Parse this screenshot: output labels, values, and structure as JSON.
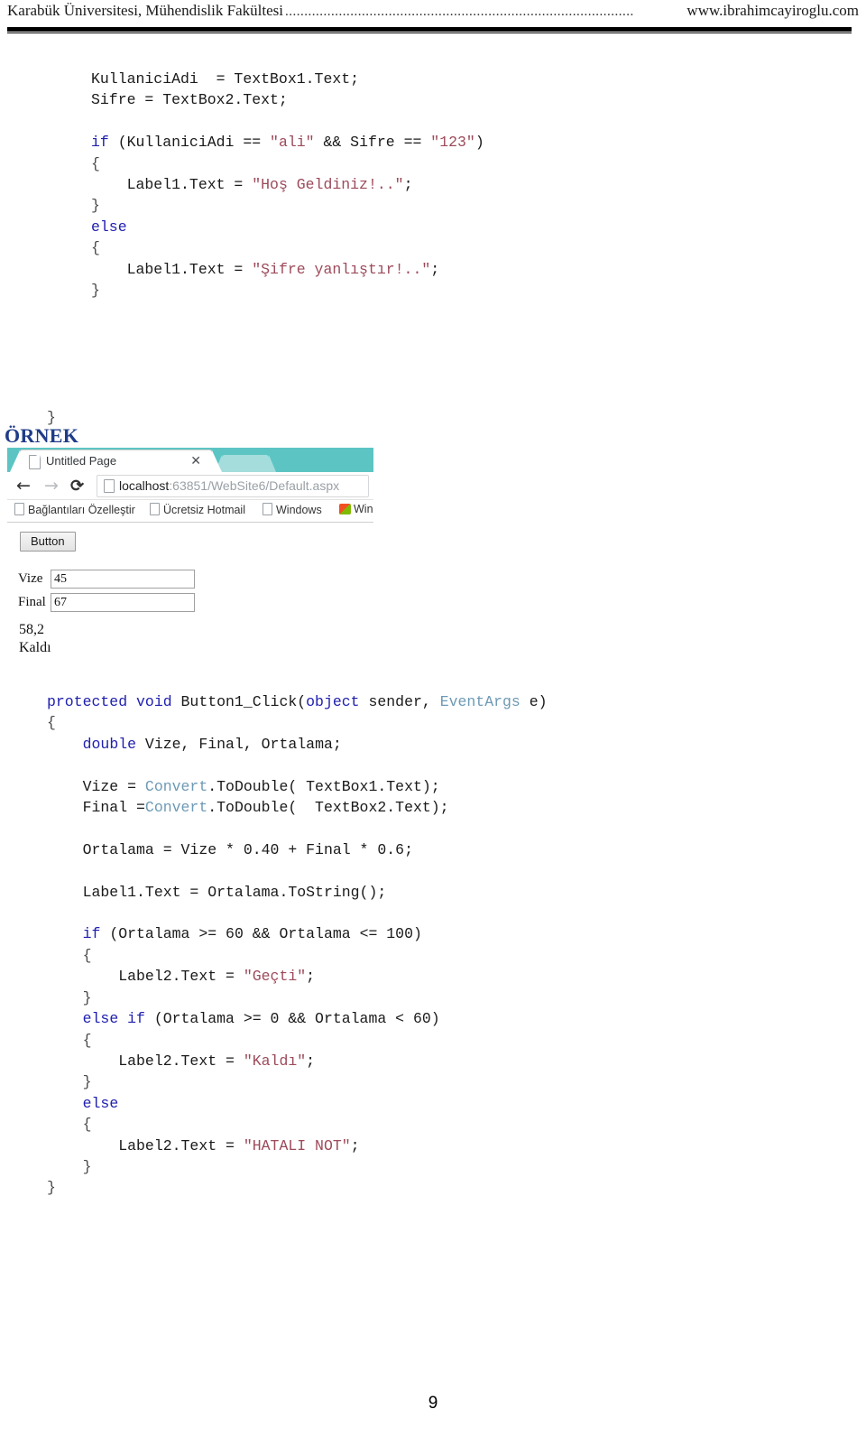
{
  "header": {
    "left": "Karabük Üniversitesi, Mühendislik Fakültesi",
    "dots": "...........................................................................................",
    "right": "www.ibrahimcayiroglu.com"
  },
  "code_block_1": {
    "lines": [
      [
        {
          "t": "KullaniciAdi  = TextBox1.Text;",
          "c": "plain"
        }
      ],
      [
        {
          "t": "Sifre = TextBox2.Text;",
          "c": "plain"
        }
      ],
      [
        {
          "t": "",
          "c": "plain"
        }
      ],
      [
        {
          "t": "if",
          "c": "kw"
        },
        {
          "t": " (KullaniciAdi == ",
          "c": "plain"
        },
        {
          "t": "\"ali\"",
          "c": "str"
        },
        {
          "t": " && Sifre == ",
          "c": "plain"
        },
        {
          "t": "\"123\"",
          "c": "str"
        },
        {
          "t": ")",
          "c": "plain"
        }
      ],
      [
        {
          "t": "{",
          "c": "brc"
        }
      ],
      [
        {
          "t": "    Label1.Text = ",
          "c": "plain"
        },
        {
          "t": "\"Hoş Geldiniz!..\"",
          "c": "str"
        },
        {
          "t": ";",
          "c": "plain"
        }
      ],
      [
        {
          "t": "}",
          "c": "brc"
        }
      ],
      [
        {
          "t": "else",
          "c": "kw"
        }
      ],
      [
        {
          "t": "{",
          "c": "brc"
        }
      ],
      [
        {
          "t": "    Label1.Text = ",
          "c": "plain"
        },
        {
          "t": "\"Şifre yanlıştır!..\"",
          "c": "str"
        },
        {
          "t": ";",
          "c": "plain"
        }
      ],
      [
        {
          "t": "}",
          "c": "brc"
        }
      ],
      [
        {
          "t": "",
          "c": "plain"
        }
      ],
      [
        {
          "t": "",
          "c": "plain"
        }
      ],
      [
        {
          "t": "",
          "c": "plain"
        }
      ],
      [
        {
          "t": "",
          "c": "plain"
        }
      ]
    ],
    "trailing_brace": "}"
  },
  "ornek_heading": "ÖRNEK",
  "browser": {
    "tab_title": "Untitled Page",
    "tab_close": "✕",
    "nav": {
      "back": "←",
      "forward": "→",
      "reload": "⟳"
    },
    "url_host": "localhost",
    "url_rest": ":63851/WebSite6/Default.aspx",
    "bookmarks": [
      "Bağlantıları Özelleştir",
      "Ücretsiz Hotmail",
      "Windows",
      "Wind"
    ],
    "page": {
      "button_label": "Button",
      "fields": [
        {
          "label": "Vize",
          "value": "45"
        },
        {
          "label": "Final",
          "value": "67"
        }
      ],
      "results": [
        "58,2",
        "Kaldı"
      ]
    }
  },
  "code_block_2": {
    "lines": [
      [
        {
          "t": "protected void",
          "c": "kw"
        },
        {
          "t": " Button1_Click(",
          "c": "plain"
        },
        {
          "t": "object",
          "c": "kw"
        },
        {
          "t": " sender, ",
          "c": "plain"
        },
        {
          "t": "EventArgs",
          "c": "typ"
        },
        {
          "t": " e)",
          "c": "plain"
        }
      ],
      [
        {
          "t": "{",
          "c": "brc"
        }
      ],
      [
        {
          "t": "    ",
          "c": "plain"
        },
        {
          "t": "double",
          "c": "kw"
        },
        {
          "t": " Vize, Final, Ortalama;",
          "c": "plain"
        }
      ],
      [
        {
          "t": "",
          "c": "plain"
        }
      ],
      [
        {
          "t": "    Vize = ",
          "c": "plain"
        },
        {
          "t": "Convert",
          "c": "typ"
        },
        {
          "t": ".ToDouble( TextBox1.Text);",
          "c": "plain"
        }
      ],
      [
        {
          "t": "    Final =",
          "c": "plain"
        },
        {
          "t": "Convert",
          "c": "typ"
        },
        {
          "t": ".ToDouble(  TextBox2.Text);",
          "c": "plain"
        }
      ],
      [
        {
          "t": "",
          "c": "plain"
        }
      ],
      [
        {
          "t": "    Ortalama = Vize * 0.40 + Final * 0.6;",
          "c": "plain"
        }
      ],
      [
        {
          "t": "",
          "c": "plain"
        }
      ],
      [
        {
          "t": "    Label1.Text = Ortalama.ToString();",
          "c": "plain"
        }
      ],
      [
        {
          "t": "",
          "c": "plain"
        }
      ],
      [
        {
          "t": "    ",
          "c": "plain"
        },
        {
          "t": "if",
          "c": "kw"
        },
        {
          "t": " (Ortalama >= 60 && Ortalama <= 100)",
          "c": "plain"
        }
      ],
      [
        {
          "t": "    {",
          "c": "brc"
        }
      ],
      [
        {
          "t": "        Label2.Text = ",
          "c": "plain"
        },
        {
          "t": "\"Geçti\"",
          "c": "str"
        },
        {
          "t": ";",
          "c": "plain"
        }
      ],
      [
        {
          "t": "    }",
          "c": "brc"
        }
      ],
      [
        {
          "t": "    ",
          "c": "plain"
        },
        {
          "t": "else if",
          "c": "kw"
        },
        {
          "t": " (Ortalama >= 0 && Ortalama < 60)",
          "c": "plain"
        }
      ],
      [
        {
          "t": "    {",
          "c": "brc"
        }
      ],
      [
        {
          "t": "        Label2.Text = ",
          "c": "plain"
        },
        {
          "t": "\"Kaldı\"",
          "c": "str"
        },
        {
          "t": ";",
          "c": "plain"
        }
      ],
      [
        {
          "t": "    }",
          "c": "brc"
        }
      ],
      [
        {
          "t": "    ",
          "c": "plain"
        },
        {
          "t": "else",
          "c": "kw"
        }
      ],
      [
        {
          "t": "    {",
          "c": "brc"
        }
      ],
      [
        {
          "t": "        Label2.Text = ",
          "c": "plain"
        },
        {
          "t": "\"HATALI NOT\"",
          "c": "str"
        },
        {
          "t": ";",
          "c": "plain"
        }
      ],
      [
        {
          "t": "    }",
          "c": "brc"
        }
      ],
      [
        {
          "t": "}",
          "c": "brc"
        }
      ]
    ]
  },
  "page_number": "9"
}
